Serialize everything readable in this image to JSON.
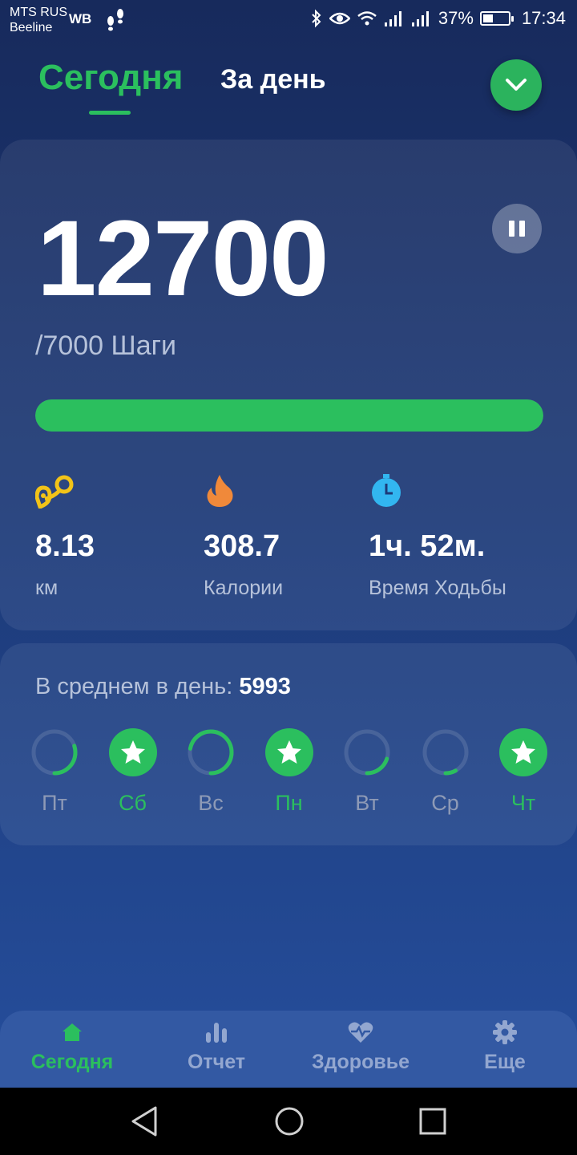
{
  "status_bar": {
    "carrier_1": "MTS RUS",
    "carrier_2": "Beeline",
    "app_badge": "WB",
    "battery_percent": "37%",
    "time": "17:34",
    "battery_level": 0.37
  },
  "tabs": {
    "today": "Сегодня",
    "per_day": "За день"
  },
  "summary": {
    "steps": "12700",
    "goal": "/7000 Шаги",
    "progress": 1.0,
    "stats": [
      {
        "icon": "distance-pin-icon",
        "value": "8.13",
        "label": "км"
      },
      {
        "icon": "flame-icon",
        "value": "308.7",
        "label": "Калории"
      },
      {
        "icon": "stopwatch-icon",
        "value": "1ч. 52м.",
        "label": "Время Ходьбы"
      }
    ]
  },
  "week": {
    "avg_label": "В среднем в день: ",
    "avg_value": "5993",
    "days": [
      {
        "label": "Пт",
        "done": false,
        "progress": 0.3
      },
      {
        "label": "Сб",
        "done": true,
        "progress": 1.0
      },
      {
        "label": "Вс",
        "done": false,
        "progress": 0.72
      },
      {
        "label": "Пн",
        "done": true,
        "progress": 1.0
      },
      {
        "label": "Вт",
        "done": false,
        "progress": 0.2
      },
      {
        "label": "Ср",
        "done": false,
        "progress": 0.08
      },
      {
        "label": "Чт",
        "done": true,
        "progress": 1.0
      }
    ]
  },
  "bottom_nav": [
    {
      "icon": "home-icon",
      "label": "Сегодня",
      "active": true
    },
    {
      "icon": "bar-chart-icon",
      "label": "Отчет",
      "active": false
    },
    {
      "icon": "heart-pulse-icon",
      "label": "Здоровье",
      "active": false
    },
    {
      "icon": "gear-icon",
      "label": "Еще",
      "active": false
    }
  ],
  "colors": {
    "accent": "#2bbf5e",
    "background": "#1d3a78",
    "distance_icon": "#f2c318",
    "flame_icon": "#f0893a",
    "stopwatch_icon": "#32b6f0"
  }
}
